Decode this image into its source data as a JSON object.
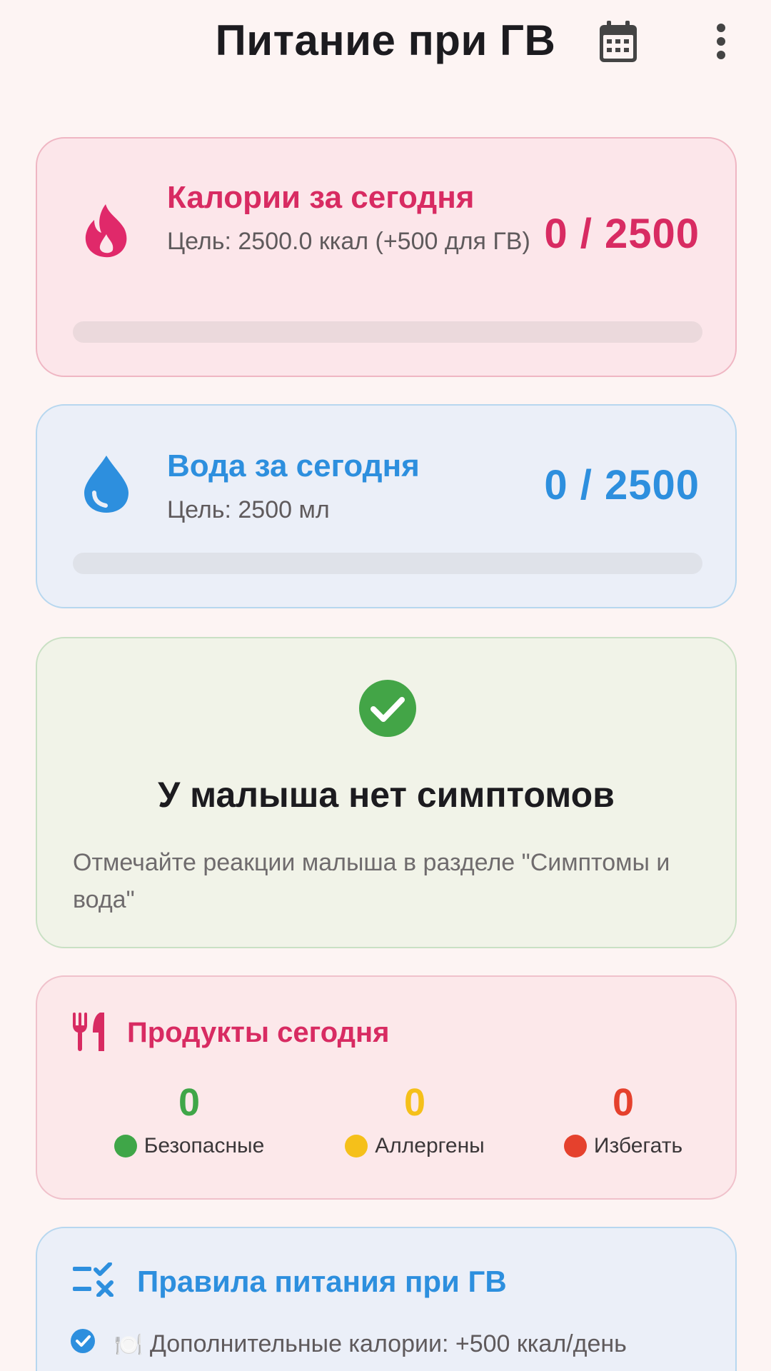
{
  "app_bar": {
    "title": "Питание при ГВ",
    "calendar_icon": "calendar-icon",
    "more_icon": "more-vert-icon"
  },
  "calories": {
    "icon": "fire-icon",
    "title": "Калории за сегодня",
    "subtitle": "Цель: 2500.0 ккал (+500 для ГВ)",
    "value": "0 / 2500",
    "progress": 0,
    "accent": "#d82b62"
  },
  "water": {
    "icon": "water-drop-icon",
    "title": "Вода за сегодня",
    "subtitle": "Цель: 2500 мл",
    "value": "0 / 2500",
    "progress": 0,
    "accent": "#2d8fde"
  },
  "baby": {
    "icon": "check-circle-icon",
    "title": "У малыша нет симптомов",
    "hint": "Отмечайте реакции малыша в разделе \"Симптомы и вода\""
  },
  "products": {
    "icon": "restaurant-icon",
    "title": "Продукты сегодня",
    "stats": [
      {
        "value": "0",
        "label": "Безопасные",
        "color": "#3fa648"
      },
      {
        "value": "0",
        "label": "Аллергены",
        "color": "#f5c01a"
      },
      {
        "value": "0",
        "label": "Избегать",
        "color": "#e5412d"
      }
    ]
  },
  "rules": {
    "icon": "checklist-icon",
    "title": "Правила питания при ГВ",
    "items": [
      {
        "emoji": "🍽️",
        "text": "Дополнительные калории: +500 ккал/день"
      }
    ]
  }
}
